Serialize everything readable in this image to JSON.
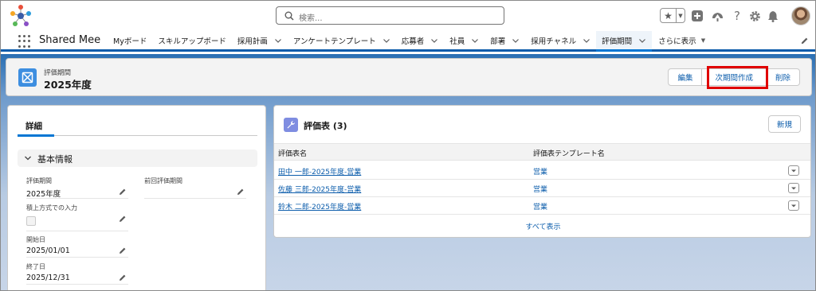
{
  "header": {
    "search_placeholder": "検索...",
    "icons": [
      "favorites-star-icon",
      "add-icon",
      "trailhead-icon",
      "help-icon",
      "setup-gear-icon",
      "notifications-bell-icon",
      "user-avatar"
    ]
  },
  "nav": {
    "app_name": "Shared Mee",
    "items": [
      {
        "label": "Myボード",
        "has_menu": false
      },
      {
        "label": "スキルアップボード",
        "has_menu": false
      },
      {
        "label": "採用計画",
        "has_menu": true
      },
      {
        "label": "アンケートテンプレート",
        "has_menu": true
      },
      {
        "label": "応募者",
        "has_menu": true
      },
      {
        "label": "社員",
        "has_menu": true
      },
      {
        "label": "部署",
        "has_menu": true
      },
      {
        "label": "採用チャネル",
        "has_menu": true
      },
      {
        "label": "評価期間",
        "has_menu": true,
        "active": true
      }
    ],
    "more_label": "さらに表示"
  },
  "record": {
    "object_label": "評価期間",
    "title": "2025年度",
    "buttons": {
      "edit": "編集",
      "create_next": "次期間作成",
      "delete": "削除"
    }
  },
  "details": {
    "tab_label": "詳細",
    "section_label": "基本情報",
    "fields": {
      "period": {
        "label": "評価期間",
        "value": "2025年度"
      },
      "previous_period": {
        "label": "前回評価期間",
        "value": ""
      },
      "bottom_up": {
        "label": "積上方式での入力",
        "checked": false
      },
      "start_date": {
        "label": "開始日",
        "value": "2025/01/01"
      },
      "end_date": {
        "label": "終了日",
        "value": "2025/12/31"
      }
    }
  },
  "related": {
    "title": "評価表 (3)",
    "new_button": "新規",
    "columns": [
      "評価表名",
      "評価表テンプレート名"
    ],
    "rows": [
      {
        "name": "田中 一郎-2025年度-営業",
        "template": "営業"
      },
      {
        "name": "佐藤 三郎-2025年度-営業",
        "template": "営業"
      },
      {
        "name": "鈴木 二郎-2025年度-営業",
        "template": "営業"
      }
    ],
    "view_all": "すべて表示"
  },
  "colors": {
    "brand": "#0176d3",
    "link": "#0b5cab",
    "highlight": "#e00000"
  }
}
